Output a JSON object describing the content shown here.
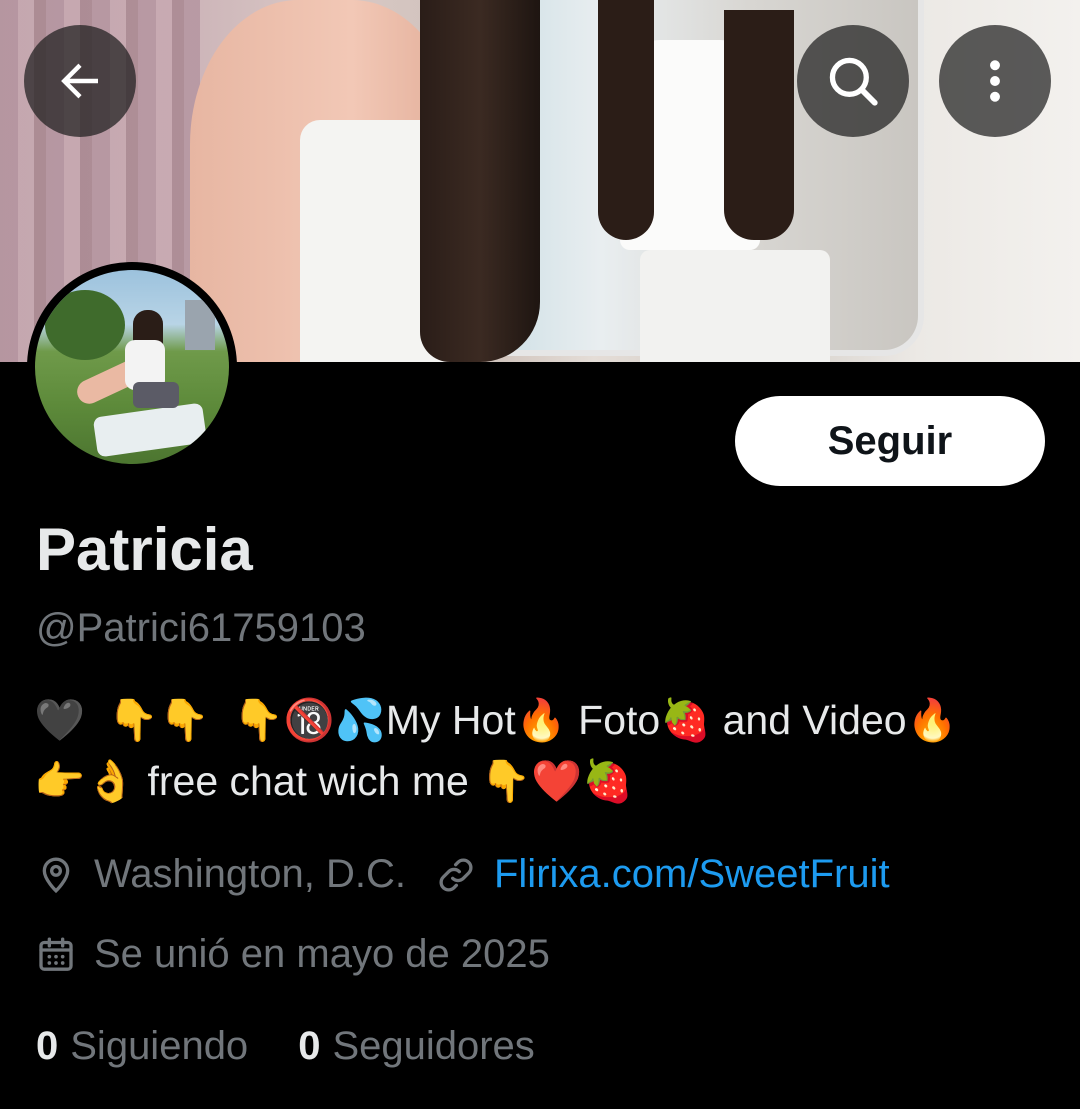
{
  "profile": {
    "name": "Patricia",
    "handle": "@Patrici61759103",
    "bio": "🖤  👇👇  👇🔞💦My Hot🔥 Foto🍓 and Video🔥\n👉👌 free chat wich me 👇❤️🍓",
    "location": "Washington, D.C.",
    "website": "Flirixa.com/SweetFruit",
    "joined": "Se unió en mayo de 2025",
    "following_count": "0",
    "following_label": "Siguiendo",
    "followers_count": "0",
    "followers_label": "Seguidores"
  },
  "actions": {
    "follow_label": "Seguir"
  },
  "icons": {
    "back": "arrow-left-icon",
    "search": "search-icon",
    "more": "more-vertical-icon",
    "location": "map-pin-icon",
    "link": "link-icon",
    "calendar": "calendar-icon"
  },
  "colors": {
    "background": "#000000",
    "primary_text": "#e7e9ea",
    "secondary_text": "#71767b",
    "link": "#1d9bf0",
    "follow_button_bg": "#ffffff",
    "follow_button_text": "#0f1419"
  }
}
